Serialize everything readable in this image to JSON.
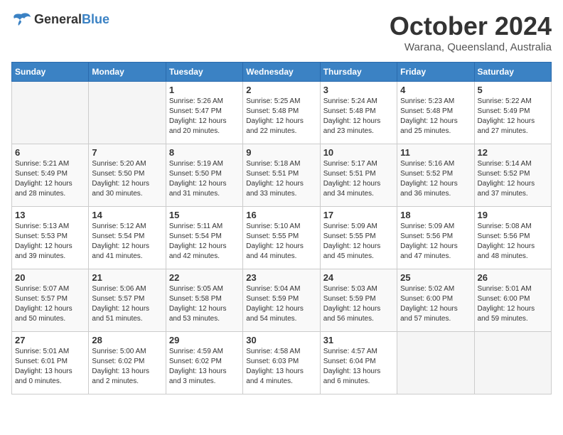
{
  "header": {
    "logo_general": "General",
    "logo_blue": "Blue",
    "month": "October 2024",
    "location": "Warana, Queensland, Australia"
  },
  "days_of_week": [
    "Sunday",
    "Monday",
    "Tuesday",
    "Wednesday",
    "Thursday",
    "Friday",
    "Saturday"
  ],
  "weeks": [
    [
      {
        "day": "",
        "sunrise": "",
        "sunset": "",
        "daylight": ""
      },
      {
        "day": "",
        "sunrise": "",
        "sunset": "",
        "daylight": ""
      },
      {
        "day": "1",
        "sunrise": "Sunrise: 5:26 AM",
        "sunset": "Sunset: 5:47 PM",
        "daylight": "Daylight: 12 hours and 20 minutes."
      },
      {
        "day": "2",
        "sunrise": "Sunrise: 5:25 AM",
        "sunset": "Sunset: 5:48 PM",
        "daylight": "Daylight: 12 hours and 22 minutes."
      },
      {
        "day": "3",
        "sunrise": "Sunrise: 5:24 AM",
        "sunset": "Sunset: 5:48 PM",
        "daylight": "Daylight: 12 hours and 23 minutes."
      },
      {
        "day": "4",
        "sunrise": "Sunrise: 5:23 AM",
        "sunset": "Sunset: 5:48 PM",
        "daylight": "Daylight: 12 hours and 25 minutes."
      },
      {
        "day": "5",
        "sunrise": "Sunrise: 5:22 AM",
        "sunset": "Sunset: 5:49 PM",
        "daylight": "Daylight: 12 hours and 27 minutes."
      }
    ],
    [
      {
        "day": "6",
        "sunrise": "Sunrise: 5:21 AM",
        "sunset": "Sunset: 5:49 PM",
        "daylight": "Daylight: 12 hours and 28 minutes."
      },
      {
        "day": "7",
        "sunrise": "Sunrise: 5:20 AM",
        "sunset": "Sunset: 5:50 PM",
        "daylight": "Daylight: 12 hours and 30 minutes."
      },
      {
        "day": "8",
        "sunrise": "Sunrise: 5:19 AM",
        "sunset": "Sunset: 5:50 PM",
        "daylight": "Daylight: 12 hours and 31 minutes."
      },
      {
        "day": "9",
        "sunrise": "Sunrise: 5:18 AM",
        "sunset": "Sunset: 5:51 PM",
        "daylight": "Daylight: 12 hours and 33 minutes."
      },
      {
        "day": "10",
        "sunrise": "Sunrise: 5:17 AM",
        "sunset": "Sunset: 5:51 PM",
        "daylight": "Daylight: 12 hours and 34 minutes."
      },
      {
        "day": "11",
        "sunrise": "Sunrise: 5:16 AM",
        "sunset": "Sunset: 5:52 PM",
        "daylight": "Daylight: 12 hours and 36 minutes."
      },
      {
        "day": "12",
        "sunrise": "Sunrise: 5:14 AM",
        "sunset": "Sunset: 5:52 PM",
        "daylight": "Daylight: 12 hours and 37 minutes."
      }
    ],
    [
      {
        "day": "13",
        "sunrise": "Sunrise: 5:13 AM",
        "sunset": "Sunset: 5:53 PM",
        "daylight": "Daylight: 12 hours and 39 minutes."
      },
      {
        "day": "14",
        "sunrise": "Sunrise: 5:12 AM",
        "sunset": "Sunset: 5:54 PM",
        "daylight": "Daylight: 12 hours and 41 minutes."
      },
      {
        "day": "15",
        "sunrise": "Sunrise: 5:11 AM",
        "sunset": "Sunset: 5:54 PM",
        "daylight": "Daylight: 12 hours and 42 minutes."
      },
      {
        "day": "16",
        "sunrise": "Sunrise: 5:10 AM",
        "sunset": "Sunset: 5:55 PM",
        "daylight": "Daylight: 12 hours and 44 minutes."
      },
      {
        "day": "17",
        "sunrise": "Sunrise: 5:09 AM",
        "sunset": "Sunset: 5:55 PM",
        "daylight": "Daylight: 12 hours and 45 minutes."
      },
      {
        "day": "18",
        "sunrise": "Sunrise: 5:09 AM",
        "sunset": "Sunset: 5:56 PM",
        "daylight": "Daylight: 12 hours and 47 minutes."
      },
      {
        "day": "19",
        "sunrise": "Sunrise: 5:08 AM",
        "sunset": "Sunset: 5:56 PM",
        "daylight": "Daylight: 12 hours and 48 minutes."
      }
    ],
    [
      {
        "day": "20",
        "sunrise": "Sunrise: 5:07 AM",
        "sunset": "Sunset: 5:57 PM",
        "daylight": "Daylight: 12 hours and 50 minutes."
      },
      {
        "day": "21",
        "sunrise": "Sunrise: 5:06 AM",
        "sunset": "Sunset: 5:57 PM",
        "daylight": "Daylight: 12 hours and 51 minutes."
      },
      {
        "day": "22",
        "sunrise": "Sunrise: 5:05 AM",
        "sunset": "Sunset: 5:58 PM",
        "daylight": "Daylight: 12 hours and 53 minutes."
      },
      {
        "day": "23",
        "sunrise": "Sunrise: 5:04 AM",
        "sunset": "Sunset: 5:59 PM",
        "daylight": "Daylight: 12 hours and 54 minutes."
      },
      {
        "day": "24",
        "sunrise": "Sunrise: 5:03 AM",
        "sunset": "Sunset: 5:59 PM",
        "daylight": "Daylight: 12 hours and 56 minutes."
      },
      {
        "day": "25",
        "sunrise": "Sunrise: 5:02 AM",
        "sunset": "Sunset: 6:00 PM",
        "daylight": "Daylight: 12 hours and 57 minutes."
      },
      {
        "day": "26",
        "sunrise": "Sunrise: 5:01 AM",
        "sunset": "Sunset: 6:00 PM",
        "daylight": "Daylight: 12 hours and 59 minutes."
      }
    ],
    [
      {
        "day": "27",
        "sunrise": "Sunrise: 5:01 AM",
        "sunset": "Sunset: 6:01 PM",
        "daylight": "Daylight: 13 hours and 0 minutes."
      },
      {
        "day": "28",
        "sunrise": "Sunrise: 5:00 AM",
        "sunset": "Sunset: 6:02 PM",
        "daylight": "Daylight: 13 hours and 2 minutes."
      },
      {
        "day": "29",
        "sunrise": "Sunrise: 4:59 AM",
        "sunset": "Sunset: 6:02 PM",
        "daylight": "Daylight: 13 hours and 3 minutes."
      },
      {
        "day": "30",
        "sunrise": "Sunrise: 4:58 AM",
        "sunset": "Sunset: 6:03 PM",
        "daylight": "Daylight: 13 hours and 4 minutes."
      },
      {
        "day": "31",
        "sunrise": "Sunrise: 4:57 AM",
        "sunset": "Sunset: 6:04 PM",
        "daylight": "Daylight: 13 hours and 6 minutes."
      },
      {
        "day": "",
        "sunrise": "",
        "sunset": "",
        "daylight": ""
      },
      {
        "day": "",
        "sunrise": "",
        "sunset": "",
        "daylight": ""
      }
    ]
  ]
}
